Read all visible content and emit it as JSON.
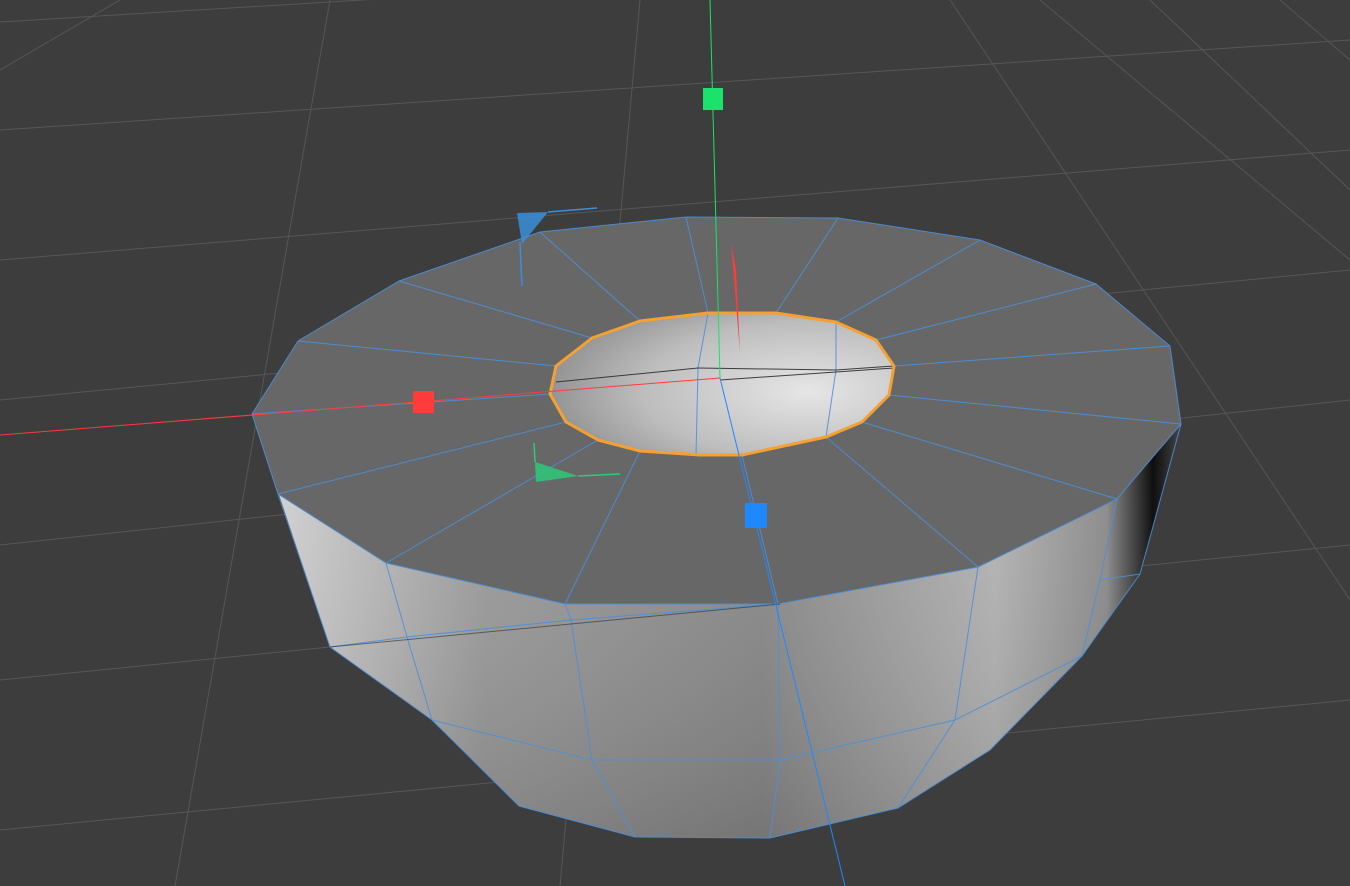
{
  "viewport": {
    "background_color": "#3d3d3d",
    "grid_color": "#565656",
    "mesh_fill": "#666666",
    "mesh_wire_color": "#4a90d9",
    "selection_color": "#f5a030",
    "axis_x_color": "#ff3b3b",
    "axis_y_color": "#1be26a",
    "axis_z_color": "#1e88ff"
  },
  "gizmo": {
    "type": "move",
    "handles": [
      "x-handle",
      "y-handle",
      "z-handle"
    ],
    "planes": [
      "xz-plane-handle",
      "xy-plane-handle"
    ]
  },
  "scene": {
    "object": "tube-mesh",
    "selection": "inner-edge-loop"
  }
}
